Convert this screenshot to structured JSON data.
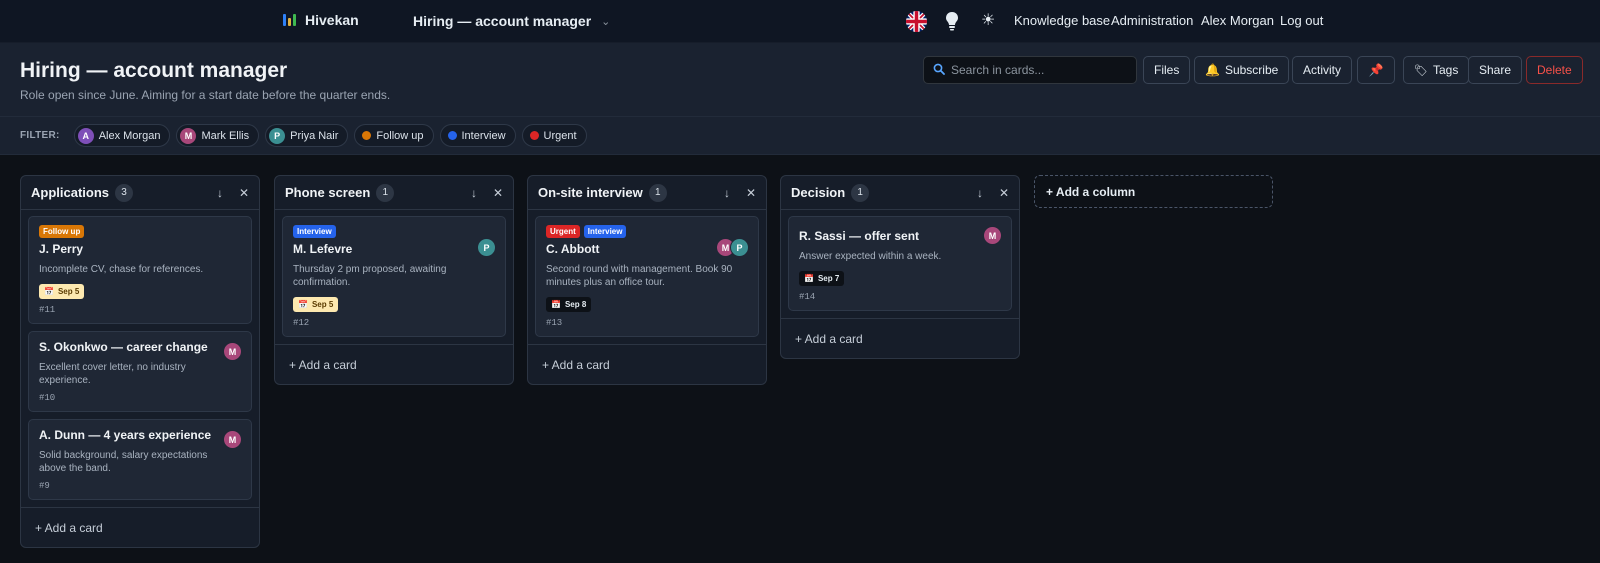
{
  "topnav": {
    "brand": "Hivekan",
    "board_name": "Hiring — account manager",
    "links": {
      "knowledge_base": "Knowledge base",
      "administration": "Administration",
      "user": "Alex Morgan",
      "logout": "Log out"
    },
    "icons": [
      "uk-flag-icon",
      "lightbulb-icon",
      "sun-icon",
      "chevron-down-icon"
    ]
  },
  "board": {
    "title": "Hiring — account manager",
    "subtitle": "Role open since June. Aiming for a start date before the quarter ends.",
    "search_placeholder": "Search in cards...",
    "actions": {
      "files": "Files",
      "subscribe": "Subscribe",
      "activity": "Activity",
      "tags": "Tags",
      "share": "Share",
      "delete": "Delete"
    }
  },
  "filter": {
    "label": "FILTER:",
    "members": [
      {
        "initial": "A",
        "name": "Alex Morgan",
        "color": "#7e4fb8"
      },
      {
        "initial": "M",
        "name": "Mark Ellis",
        "color": "#a8477a"
      },
      {
        "initial": "P",
        "name": "Priya Nair",
        "color": "#3b8f92"
      }
    ],
    "labels": [
      {
        "name": "Follow up",
        "color": "#d97706"
      },
      {
        "name": "Interview",
        "color": "#2563eb"
      },
      {
        "name": "Urgent",
        "color": "#dc2626"
      }
    ]
  },
  "colors": {
    "follow_up": "#d97706",
    "interview": "#2563eb",
    "urgent": "#dc2626",
    "member_a": "#7e4fb8",
    "member_m": "#a8477a",
    "member_p": "#3b8f92"
  },
  "columns": [
    {
      "title": "Applications",
      "count": "3",
      "add_card": "+ Add a card",
      "cards": [
        {
          "labels": [
            {
              "text": "Follow up",
              "color": "#d97706"
            }
          ],
          "title": "J. Perry",
          "desc": "Incomplete CV, chase for references.",
          "due": "Sep 5",
          "due_style": "warn",
          "id": "#11",
          "members": []
        },
        {
          "labels": [],
          "title": "S. Okonkwo — career change",
          "desc": "Excellent cover letter, no industry experience.",
          "due": "",
          "id": "#10",
          "members": [
            {
              "initial": "M",
              "color": "#a8477a"
            }
          ]
        },
        {
          "labels": [],
          "title": "A. Dunn — 4 years experience",
          "desc": "Solid background, salary expectations above the band.",
          "due": "",
          "id": "#9",
          "members": [
            {
              "initial": "M",
              "color": "#a8477a"
            }
          ]
        }
      ]
    },
    {
      "title": "Phone screen",
      "count": "1",
      "add_card": "+ Add a card",
      "cards": [
        {
          "labels": [
            {
              "text": "Interview",
              "color": "#2563eb"
            }
          ],
          "title": "M. Lefevre",
          "desc": "Thursday 2 pm proposed, awaiting confirmation.",
          "due": "Sep 5",
          "due_style": "warn",
          "id": "#12",
          "members": [
            {
              "initial": "P",
              "color": "#3b8f92"
            }
          ]
        }
      ]
    },
    {
      "title": "On-site interview",
      "count": "1",
      "add_card": "+ Add a card",
      "cards": [
        {
          "labels": [
            {
              "text": "Urgent",
              "color": "#dc2626"
            },
            {
              "text": "Interview",
              "color": "#2563eb"
            }
          ],
          "title": "C. Abbott",
          "desc": "Second round with management. Book 90 minutes plus an office tour.",
          "due": "Sep 8",
          "due_style": "plain",
          "id": "#13",
          "members": [
            {
              "initial": "M",
              "color": "#a8477a"
            },
            {
              "initial": "P",
              "color": "#3b8f92"
            }
          ]
        }
      ]
    },
    {
      "title": "Decision",
      "count": "1",
      "add_card": "+ Add a card",
      "cards": [
        {
          "labels": [],
          "title": "R. Sassi — offer sent",
          "desc": "Answer expected within a week.",
          "due": "Sep 7",
          "due_style": "plain",
          "id": "#14",
          "members": [
            {
              "initial": "M",
              "color": "#a8477a"
            }
          ]
        }
      ]
    }
  ],
  "add_column": "+ Add a column"
}
